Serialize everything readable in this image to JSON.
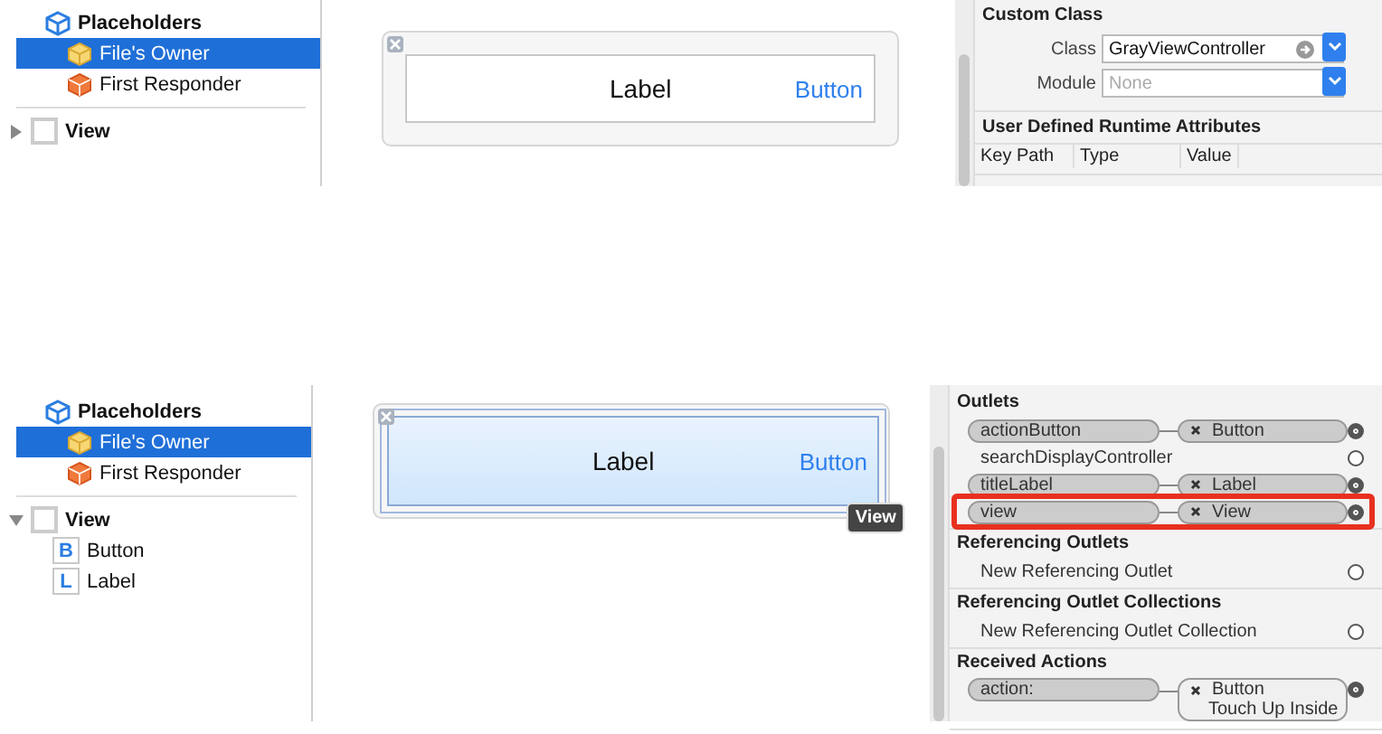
{
  "panels": [
    {
      "outline": [
        {
          "label": "Placeholders",
          "kind": "group",
          "selected": false,
          "children": [
            {
              "label": "File's Owner",
              "kind": "owner",
              "selected": true
            },
            {
              "label": "First Responder",
              "kind": "responder",
              "selected": false
            }
          ]
        },
        {
          "label": "View",
          "kind": "view",
          "selected": false,
          "expanded": false
        }
      ],
      "canvas": {
        "label": "Label",
        "button": "Button",
        "selected": false
      },
      "inspector": [
        {
          "kind": "custom_class",
          "title": "Custom Class",
          "fields": [
            {
              "label": "Class",
              "value": "GrayViewController"
            },
            {
              "label": "Module",
              "placeholder": "None"
            }
          ]
        },
        {
          "kind": "attributes",
          "title": "User Defined Runtime Attributes",
          "columns": [
            "Key Path",
            "Type",
            "Value"
          ]
        }
      ]
    },
    {
      "outline": [
        {
          "label": "Placeholders",
          "kind": "group",
          "selected": false,
          "children": [
            {
              "label": "File's Owner",
              "kind": "owner",
              "selected": true
            },
            {
              "label": "First Responder",
              "kind": "responder",
              "selected": false
            }
          ]
        },
        {
          "label": "View",
          "kind": "view",
          "selected": false,
          "expanded": true,
          "children": [
            {
              "label": "Button",
              "kind": "letter",
              "glyph": "B",
              "selected": false
            },
            {
              "label": "Label",
              "kind": "letter",
              "glyph": "L",
              "selected": false
            }
          ]
        }
      ],
      "canvas": {
        "label": "Label",
        "button": "Button",
        "selected": true,
        "tooltip": "View"
      },
      "inspector": [
        {
          "kind": "connections",
          "title": "Outlets",
          "rows": [
            {
              "name": "actionButton",
              "target": "Button",
              "connected": true,
              "highlighted": false
            },
            {
              "name": "searchDisplayController",
              "connected": false,
              "highlighted": false
            },
            {
              "name": "titleLabel",
              "target": "Label",
              "connected": true,
              "highlighted": false
            },
            {
              "name": "view",
              "target": "View",
              "connected": true,
              "highlighted": true
            }
          ]
        },
        {
          "kind": "connections",
          "title": "Referencing Outlets",
          "rows": [
            {
              "name": "New Referencing Outlet",
              "connected": false,
              "highlighted": false
            }
          ]
        },
        {
          "kind": "connections",
          "title": "Referencing Outlet Collections",
          "rows": [
            {
              "name": "New Referencing Outlet Collection",
              "connected": false,
              "highlighted": false
            }
          ]
        },
        {
          "kind": "connections",
          "title": "Received Actions",
          "rows": [
            {
              "name": "action:",
              "target": "Button",
              "detail": "Touch Up Inside",
              "connected": true,
              "highlighted": false
            }
          ]
        }
      ]
    }
  ]
}
